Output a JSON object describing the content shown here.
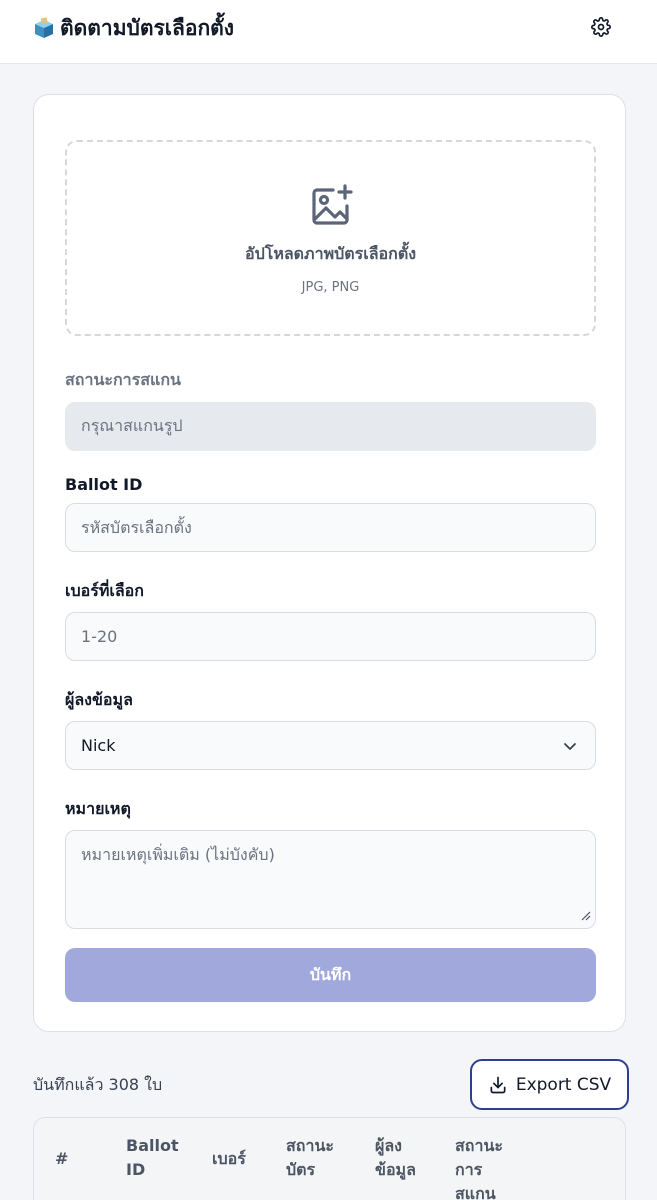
{
  "header": {
    "app_icon": "ballot-box-icon",
    "title": "ติดตามบัตรเลือกตั้ง",
    "settings_icon": "gear-icon"
  },
  "upload": {
    "icon": "image-add-icon",
    "title": "อัปโหลดภาพบัตรเลือกตั้ง",
    "formats": "JPG, PNG"
  },
  "scan_status": {
    "label": "สถานะการสแกน",
    "value": "กรุณาสแกนรูป"
  },
  "ballot_id": {
    "label": "Ballot ID",
    "placeholder": "รหัสบัตรเลือกตั้ง"
  },
  "number": {
    "label": "เบอร์ที่เลือก",
    "placeholder": "1-20"
  },
  "recorder": {
    "label": "ผู้ลงข้อมูล",
    "selected": "Nick"
  },
  "note": {
    "label": "หมายเหตุ",
    "placeholder": "หมายเหตุเพิ่มเติม (ไม่บังคับ)"
  },
  "save_label": "บันทึก",
  "records": {
    "count_text": "บันทึกแล้ว 308 ใบ",
    "export_label": "Export CSV",
    "columns": [
      "#",
      "Ballot ID",
      "เบอร์",
      "สถานะบัตร",
      "ผู้ลงข้อมูล",
      "สถานะการสแกน"
    ]
  },
  "colors": {
    "accent": "#a1a9dc",
    "export_border": "#2f3f8f",
    "background": "#f3f5f9"
  }
}
